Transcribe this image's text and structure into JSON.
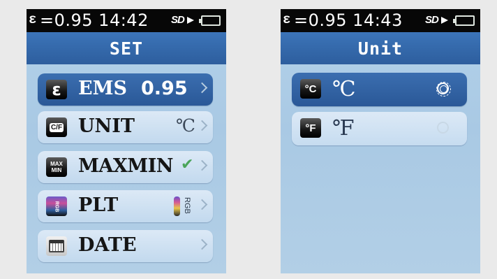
{
  "left_screen": {
    "status": {
      "epsilon": "ε",
      "text": "=0.95 14:42",
      "sd": "SD"
    },
    "header": {
      "title": "SET"
    },
    "menu": [
      {
        "icon": "emissivity-icon",
        "icon_text": "ε",
        "label": "EMS",
        "value": "0.95",
        "selected": true
      },
      {
        "icon": "c-f-icon",
        "icon_text": "C/F",
        "label": "UNIT",
        "value": "℃",
        "selected": false
      },
      {
        "icon": "max-min-icon",
        "icon_text": "MAX MIN",
        "label": "MAXMIN",
        "value": "✔",
        "selected": false
      },
      {
        "icon": "palette-icon",
        "icon_text": "RGB",
        "label": "PLT",
        "value": "RGB",
        "selected": false
      },
      {
        "icon": "calendar-icon",
        "icon_text": "",
        "label": "DATE",
        "value": "",
        "selected": false
      }
    ]
  },
  "right_screen": {
    "status": {
      "epsilon": "ε",
      "text": "=0.95 14:43",
      "sd": "SD"
    },
    "header": {
      "title": "Unit"
    },
    "options": [
      {
        "icon": "celsius-icon",
        "icon_text": "°C",
        "label": "℃",
        "selected": true
      },
      {
        "icon": "fahrenheit-icon",
        "icon_text": "°F",
        "label": "℉",
        "selected": false
      }
    ]
  },
  "colors": {
    "status_bar": "#070707",
    "header": "#336aae",
    "selected_item": "#2f609f",
    "item": "#d2e3f3",
    "battery": "#2fcc3b",
    "check": "#4aa55a"
  }
}
